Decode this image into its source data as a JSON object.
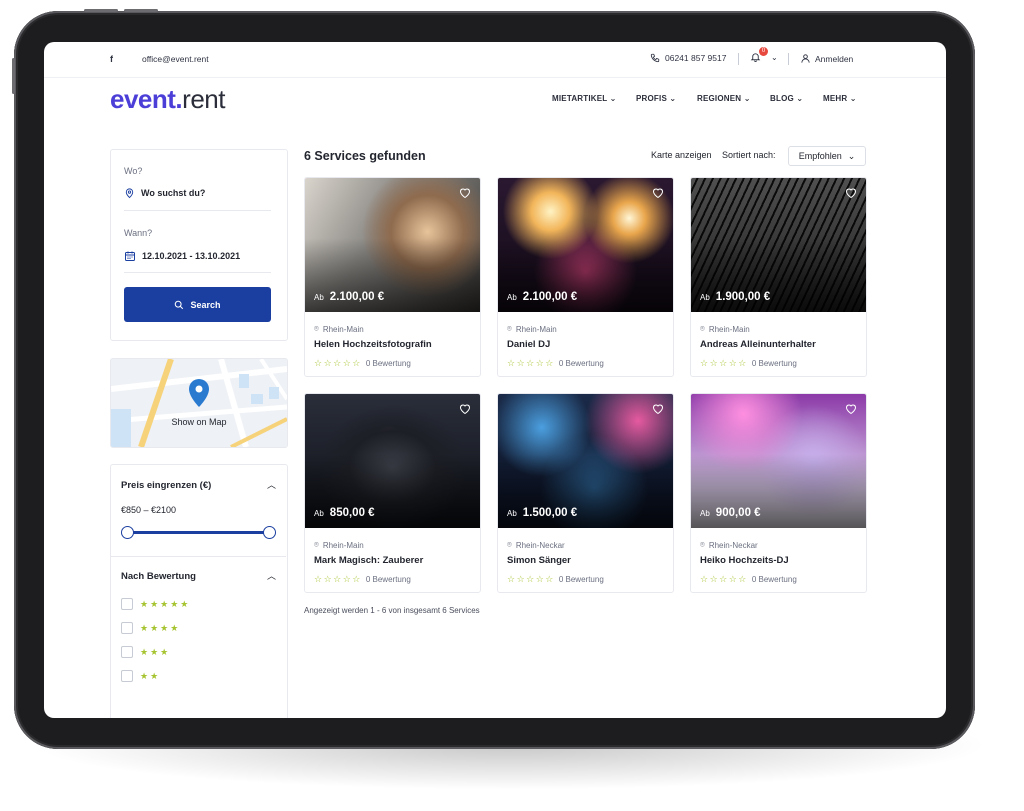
{
  "topbar": {
    "facebook": "f",
    "email": "office@event.rent",
    "phone": "06241 857 9517",
    "notification_count": "0",
    "login": "Anmelden"
  },
  "logo": {
    "part1": "event",
    "dot": ".",
    "part2": "rent"
  },
  "nav": [
    "MIETARTIKEL",
    "PROFIS",
    "REGIONEN",
    "BLOG",
    "MEHR"
  ],
  "search": {
    "where_label": "Wo?",
    "where_placeholder": "Wo suchst du?",
    "when_label": "Wann?",
    "date_range": "12.10.2021 - 13.10.2021",
    "button": "Search"
  },
  "map": {
    "label": "Show on Map"
  },
  "filters": {
    "price_title": "Preis eingrenzen (€)",
    "price_range": "€850 – €2100",
    "price_min": 850,
    "price_max": 2100,
    "rating_title": "Nach Bewertung",
    "rating_options": [
      "★★★★★",
      "★★★★",
      "★★★",
      "★★"
    ]
  },
  "results": {
    "title": "6 Services gefunden",
    "show_map": "Karte anzeigen",
    "sort_label": "Sortiert nach:",
    "sort_value": "Empfohlen",
    "footer": "Angezeigt werden 1 - 6 von insgesamt 6 Services",
    "price_prefix": "Ab",
    "items": [
      {
        "price": "2.100,00 €",
        "region": "Rhein-Main",
        "name": "Helen Hochzeitsfotografin",
        "stars": "☆☆☆☆☆",
        "rating": "0 Bewertung"
      },
      {
        "price": "2.100,00 €",
        "region": "Rhein-Main",
        "name": "Daniel DJ",
        "stars": "☆☆☆☆☆",
        "rating": "0 Bewertung"
      },
      {
        "price": "1.900,00 €",
        "region": "Rhein-Main",
        "name": "Andreas Alleinunterhalter",
        "stars": "☆☆☆☆☆",
        "rating": "0 Bewertung"
      },
      {
        "price": "850,00 €",
        "region": "Rhein-Main",
        "name": "Mark Magisch: Zauberer",
        "stars": "☆☆☆☆☆",
        "rating": "0 Bewertung"
      },
      {
        "price": "1.500,00 €",
        "region": "Rhein-Neckar",
        "name": "Simon Sänger",
        "stars": "☆☆☆☆☆",
        "rating": "0 Bewertung"
      },
      {
        "price": "900,00 €",
        "region": "Rhein-Neckar",
        "name": "Heiko Hochzeits-DJ",
        "stars": "☆☆☆☆☆",
        "rating": "0 Bewertung"
      }
    ]
  },
  "colors": {
    "brand": "#4c3fd8",
    "button": "#1b3fa0",
    "stars": "#a6c430"
  }
}
